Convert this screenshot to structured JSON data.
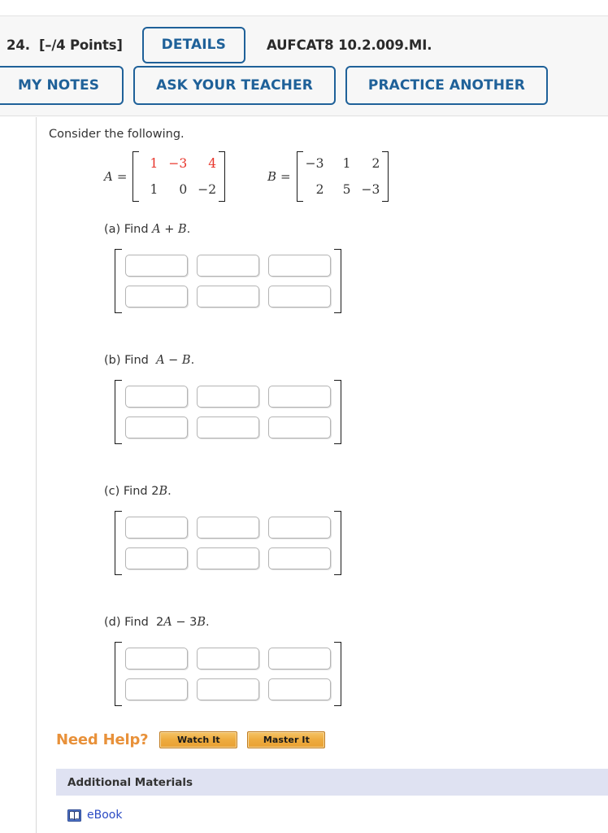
{
  "header": {
    "question_number": "24.",
    "points": "[–/4 Points]",
    "details_button": "DETAILS",
    "question_code": "AUFCAT8 10.2.009.MI.",
    "my_notes_button": "MY NOTES",
    "ask_teacher_button": "ASK YOUR TEACHER",
    "practice_another_button": "PRACTICE ANOTHER",
    "accent_color": "#1f6199"
  },
  "problem": {
    "intro": "Consider the following.",
    "matrix_a": {
      "label": "A",
      "equals": "=",
      "rows": [
        [
          {
            "text": "1",
            "color": "red"
          },
          {
            "text": "−3",
            "color": "red"
          },
          {
            "text": "4",
            "color": "red"
          }
        ],
        [
          {
            "text": "1",
            "color": "black"
          },
          {
            "text": "0",
            "color": "black"
          },
          {
            "text": "−2",
            "color": "black"
          }
        ]
      ],
      "highlight_color": "#e8342a"
    },
    "matrix_b": {
      "label": "B",
      "equals": "=",
      "rows": [
        [
          {
            "text": "−3",
            "color": "black"
          },
          {
            "text": "1",
            "color": "black"
          },
          {
            "text": "2",
            "color": "black"
          }
        ],
        [
          {
            "text": "2",
            "color": "black"
          },
          {
            "text": "5",
            "color": "black"
          },
          {
            "text": "−3",
            "color": "black"
          }
        ]
      ]
    },
    "parts": [
      {
        "id": "a",
        "prefix": "(a) Find ",
        "expr_html": "<i>A</i> + <i>B</i>.",
        "inputs": [
          [
            "",
            "",
            ""
          ],
          [
            "",
            "",
            ""
          ]
        ]
      },
      {
        "id": "b",
        "prefix": "(b) Find ",
        "expr_html": "&nbsp;<i>A</i> − <i>B</i>.",
        "inputs": [
          [
            "",
            "",
            ""
          ],
          [
            "",
            "",
            ""
          ]
        ]
      },
      {
        "id": "c",
        "prefix": "(c) Find ",
        "expr_html": "2<i>B</i>.",
        "inputs": [
          [
            "",
            "",
            ""
          ],
          [
            "",
            "",
            ""
          ]
        ]
      },
      {
        "id": "d",
        "prefix": "(d) Find ",
        "expr_html": "&nbsp;2<i>A</i> − 3<i>B</i>.",
        "inputs": [
          [
            "",
            "",
            ""
          ],
          [
            "",
            "",
            ""
          ]
        ]
      }
    ]
  },
  "need_help": {
    "label": "Need Help?",
    "label_color": "#e8913a",
    "buttons": [
      {
        "label": "Watch It"
      },
      {
        "label": "Master It"
      }
    ]
  },
  "additional_materials": {
    "title": "Additional Materials",
    "header_color": "#dfe2f2",
    "items": [
      {
        "icon": "ebook-icon",
        "label": "eBook",
        "link_color": "#2b4bc4"
      }
    ]
  }
}
